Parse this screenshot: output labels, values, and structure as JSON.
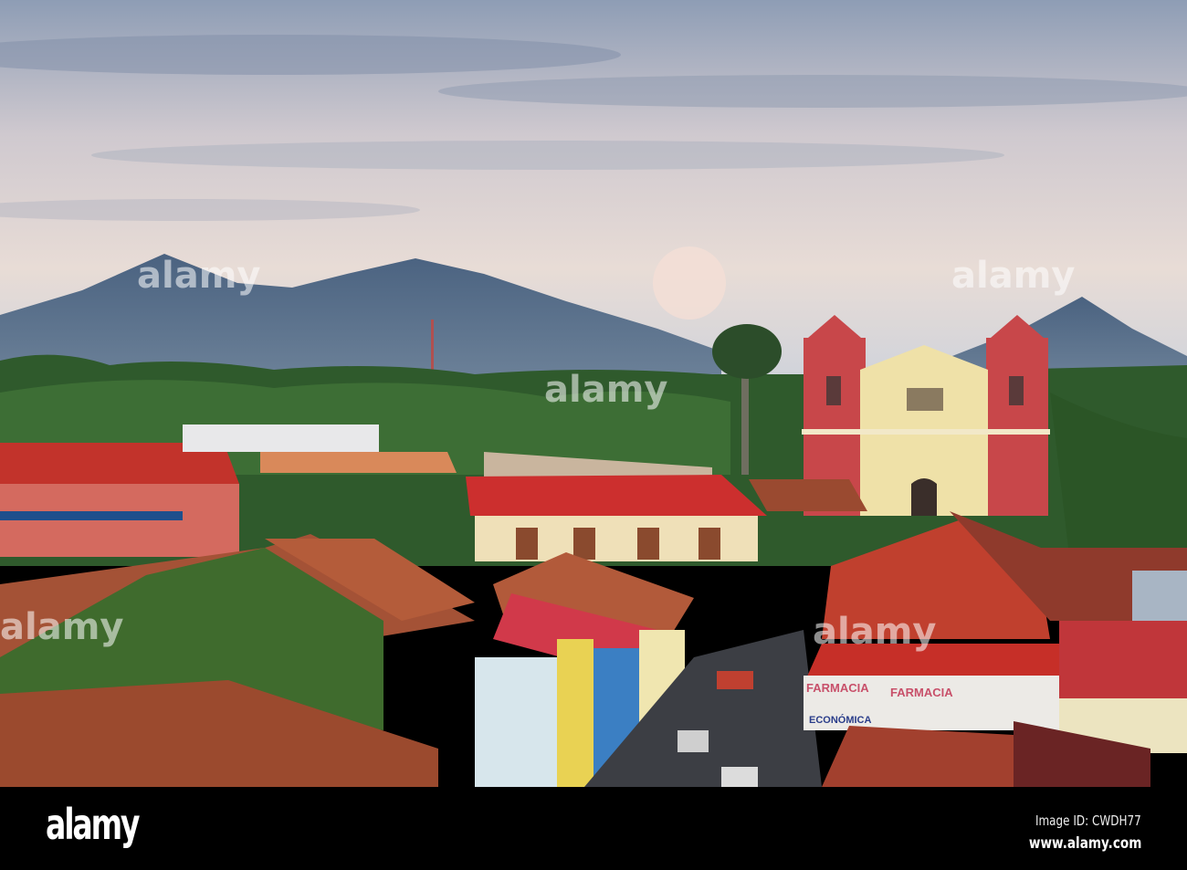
{
  "photo": {
    "subject": "city rooftops with colonial church and volcanoes",
    "signs": {
      "farmacia_left": "FARMACIA",
      "farmacia_right": "FARMACIA",
      "economica": "ECONÓMICA"
    },
    "watermark": "alamy"
  },
  "footer": {
    "logo": "alamy",
    "image_id": "Image ID: CWDH77",
    "website": "www.alamy.com"
  },
  "colors": {
    "sky_top": "#8e9db5",
    "sky_mid": "#e6dcd8",
    "mountain": "#4f6680",
    "roof_red": "#c2332b",
    "tile": "#9a4a30",
    "church_red": "#c8474a",
    "church_cream": "#efe1a8"
  }
}
